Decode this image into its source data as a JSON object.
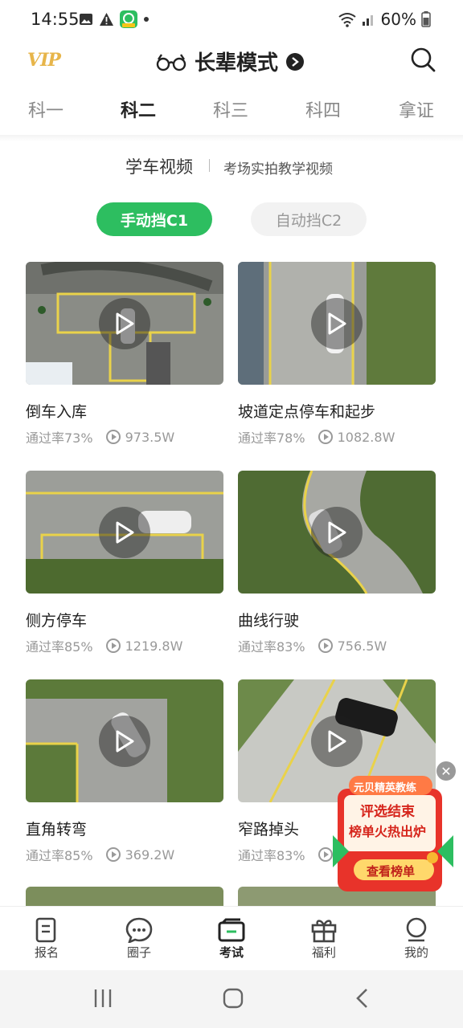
{
  "status": {
    "time": "14:55",
    "battery": "60%"
  },
  "header": {
    "vip": "VIP",
    "mode_title": "长辈模式"
  },
  "tabs": [
    {
      "label": "科一",
      "active": false
    },
    {
      "label": "科二",
      "active": true
    },
    {
      "label": "科三",
      "active": false
    },
    {
      "label": "科四",
      "active": false
    },
    {
      "label": "拿证",
      "active": false
    }
  ],
  "section": {
    "title": "学车视频",
    "subtitle": "考场实拍教学视频"
  },
  "gears": {
    "manual": "手动挡C1",
    "auto": "自动挡C2"
  },
  "videos": [
    {
      "title": "倒车入库",
      "pass_rate": "通过率73%",
      "views": "973.5W"
    },
    {
      "title": "坡道定点停车和起步",
      "pass_rate": "通过率78%",
      "views": "1082.8W"
    },
    {
      "title": "侧方停车",
      "pass_rate": "通过率85%",
      "views": "1219.8W"
    },
    {
      "title": "曲线行驶",
      "pass_rate": "通过率83%",
      "views": "756.5W"
    },
    {
      "title": "直角转弯",
      "pass_rate": "通过率85%",
      "views": "369.2W"
    },
    {
      "title": "窄路掉头",
      "pass_rate": "通过率83%",
      "views": ""
    }
  ],
  "promo": {
    "top": "元贝精英教练",
    "line1": "评选结束",
    "line2": "榜单火热出炉",
    "button": "查看榜单"
  },
  "bottom_nav": [
    {
      "label": "报名",
      "icon": "signup-icon"
    },
    {
      "label": "圈子",
      "icon": "chat-icon"
    },
    {
      "label": "考试",
      "icon": "exam-icon",
      "active": true
    },
    {
      "label": "福利",
      "icon": "gift-icon"
    },
    {
      "label": "我的",
      "icon": "profile-icon"
    }
  ],
  "colors": {
    "accent": "#2dbe60",
    "vip": "#e7b54a",
    "promo_red": "#e8332a"
  }
}
